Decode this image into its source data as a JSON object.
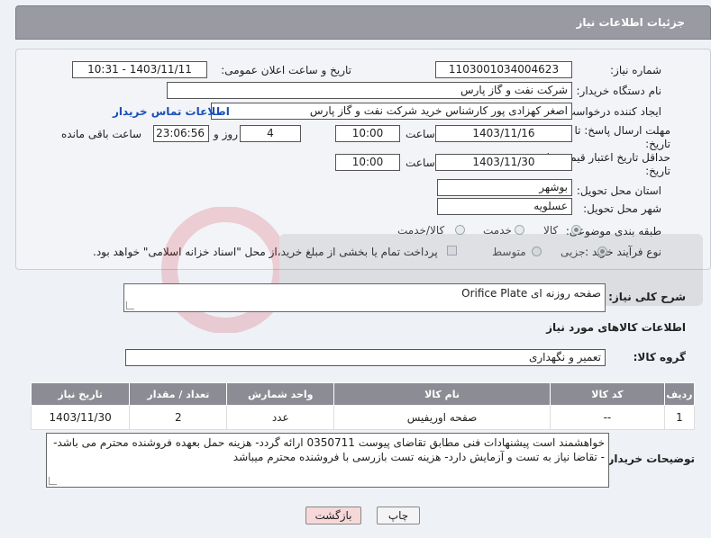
{
  "header": {
    "title": "جزئیات اطلاعات نیاز"
  },
  "form": {
    "need_number_label": "شماره نیاز:",
    "need_number": "1103001034004623",
    "announce_label": "تاریخ و ساعت اعلان عمومی:",
    "announce_value": "1403/11/11 - 10:31",
    "buyer_org_label": "نام دستگاه خریدار:",
    "buyer_org": "شرکت نفت و گاز پارس",
    "creator_label": "ایجاد کننده درخواست:",
    "creator": "اصغر کهزادی پور کارشناس خرید شرکت نفت و گاز پارس",
    "contact_link": "اطلاعات تماس خریدار",
    "deadline_label": "مهلت ارسال پاسخ: تا تاریخ:",
    "deadline_date": "1403/11/16",
    "time_label": "ساعت",
    "deadline_time": "10:00",
    "days": "4",
    "days_label": "روز و",
    "remaining_time": "23:06:56",
    "remaining_label": "ساعت باقی مانده",
    "min_price_label": "حداقل تاریخ اعتبار قیمت: تا تاریخ:",
    "min_price_date": "1403/11/30",
    "min_price_time_label": "ساعت",
    "min_price_time": "10:00",
    "province_label": "استان محل تحویل:",
    "province": "بوشهر",
    "city_label": "شهر محل تحویل:",
    "city": "عسلویه",
    "category_label": "طبقه بندی موضوعی:",
    "category_options": [
      "کالا",
      "خدمت",
      "کالا/خدمت"
    ],
    "process_label": "نوع فرآیند خرید :",
    "process_options": [
      "جزیی",
      "متوسط"
    ],
    "payment_note": "پرداخت تمام یا بخشی از مبلغ خرید،از محل \"اسناد خزانه اسلامی\" خواهد بود."
  },
  "summary": {
    "label": "شرح کلی نیاز:",
    "value": "صفحه روزنه ای Orifice Plate"
  },
  "goods_info_title": "اطلاعات کالاهای مورد نیاز",
  "goods_group": {
    "label": "گروه کالا:",
    "value": "تعمیر و نگهداری"
  },
  "table": {
    "headers": [
      "ردیف",
      "کد کالا",
      "نام کالا",
      "واحد شمارش",
      "تعداد / مقدار",
      "تاریخ نیاز"
    ],
    "rows": [
      [
        "1",
        "--",
        "صفحه اوریفیس",
        "عدد",
        "2",
        "1403/11/30"
      ]
    ]
  },
  "buyer_notes": {
    "label": "توضیحات خریدار:",
    "value": "خواهشمند است پیشنهادات فنی مطابق تقاضای پیوست 0350711 ارائه گردد- هزینه حمل بعهده فروشنده محترم می باشد-- تقاضا نیاز به تست و آزمایش دارد- هزینه تست بازرسی با فروشنده محترم میباشد"
  },
  "buttons": {
    "print": "چاپ",
    "back": "بازگشت"
  },
  "colors": {
    "header_bg": "#9a9aa2",
    "link": "#1a4fb5",
    "back_button": "#f7d8d8"
  }
}
